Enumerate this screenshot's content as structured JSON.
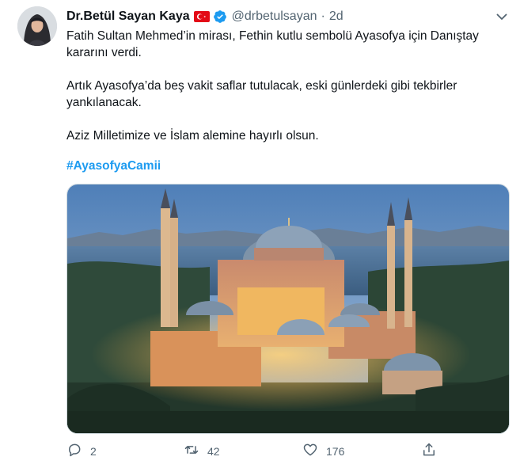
{
  "tweet": {
    "author_name": "Dr.Betül Sayan Kaya",
    "handle": "@drbetulsayan",
    "separator": "·",
    "time": "2d",
    "paragraphs": [
      "Fatih Sultan Mehmed’in mirası, Fethin kutlu sembolü Ayasofya için Danıştay kararını verdi.",
      "Artık Ayasofya’da beş vakit saflar tutulacak, eski günlerdeki gibi tekbirler yankılanacak.",
      "Aziz Milletimize ve İslam alemine hayırlı olsun."
    ],
    "hashtag": "#AyasofyaCamii"
  },
  "actions": {
    "reply_count": "2",
    "retweet_count": "42",
    "like_count": "176"
  },
  "icons": {
    "flag": "turkish-flag-icon",
    "verified": "verified-badge-icon",
    "more": "chevron-down-icon",
    "reply": "reply-icon",
    "retweet": "retweet-icon",
    "like": "heart-icon",
    "share": "share-icon"
  },
  "colors": {
    "link": "#1d9bf0",
    "secondary": "#536471",
    "verified": "#1d9bf0",
    "flag_red": "#e30a17"
  }
}
